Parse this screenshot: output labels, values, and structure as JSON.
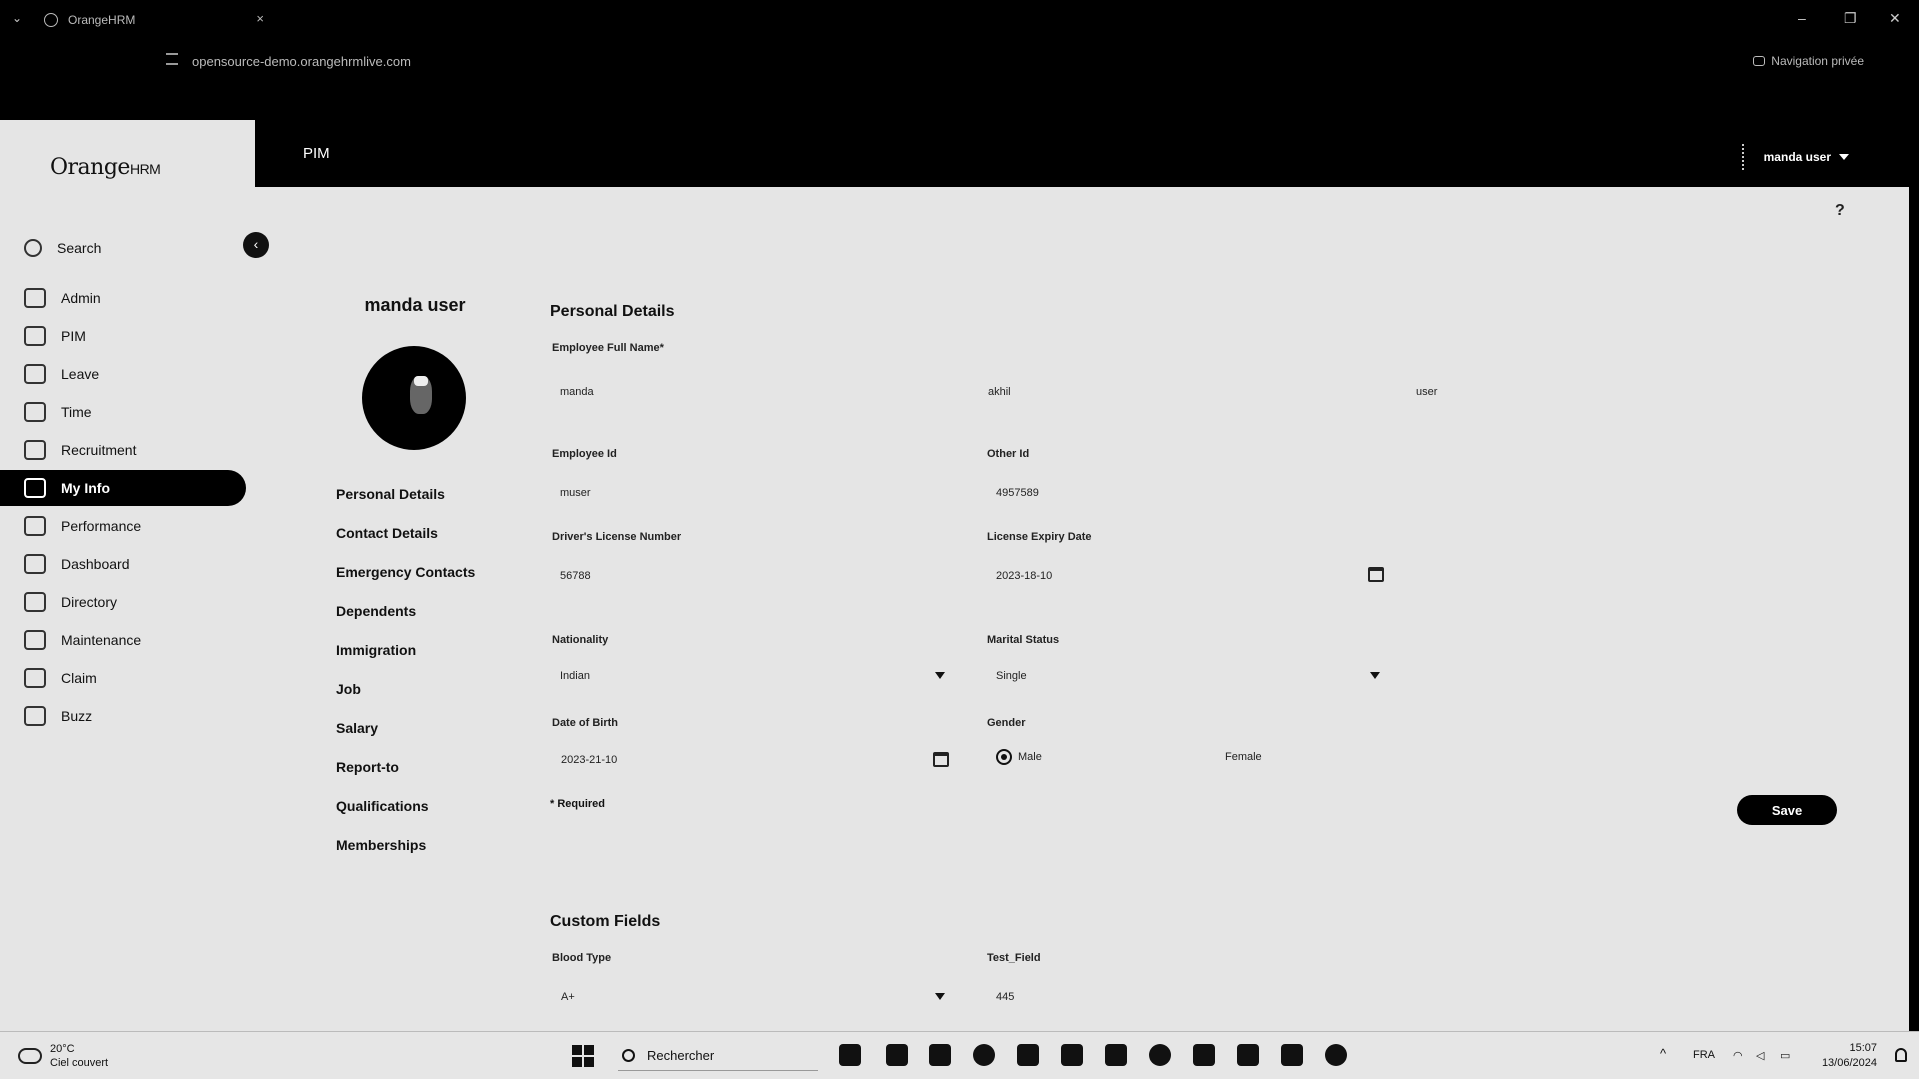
{
  "browser": {
    "tab_title": "OrangeHRM",
    "tab_close": "×",
    "url": "opensource-demo.orangehrmlive.com",
    "private_label": "Navigation privée",
    "minimize": "–",
    "restore": "❐",
    "close": "✕"
  },
  "app": {
    "logo_main": "Orange",
    "logo_suffix": "HRM",
    "header_title": "PIM",
    "user_name": "manda user",
    "help": "?"
  },
  "sidebar": {
    "collapse": "‹",
    "items": [
      {
        "label": "Search",
        "icon": "search-icon"
      },
      {
        "label": "Admin",
        "icon": "admin-icon"
      },
      {
        "label": "PIM",
        "icon": "pim-icon"
      },
      {
        "label": "Leave",
        "icon": "leave-icon"
      },
      {
        "label": "Time",
        "icon": "time-icon"
      },
      {
        "label": "Recruitment",
        "icon": "recruitment-icon"
      },
      {
        "label": "My Info",
        "icon": "my-info-icon",
        "active": true
      },
      {
        "label": "Performance",
        "icon": "performance-icon"
      },
      {
        "label": "Dashboard",
        "icon": "dashboard-icon"
      },
      {
        "label": "Directory",
        "icon": "directory-icon"
      },
      {
        "label": "Maintenance",
        "icon": "maintenance-icon"
      },
      {
        "label": "Claim",
        "icon": "claim-icon"
      },
      {
        "label": "Buzz",
        "icon": "buzz-icon"
      }
    ]
  },
  "profile": {
    "name": "manda user",
    "subnav": [
      "Personal Details",
      "Contact Details",
      "Emergency Contacts",
      "Dependents",
      "Immigration",
      "Job",
      "Salary",
      "Report-to",
      "Qualifications",
      "Memberships"
    ]
  },
  "personal": {
    "title": "Personal Details",
    "full_name_label": "Employee Full Name*",
    "first_name": "manda",
    "middle_name": "akhil",
    "last_name": "user",
    "employee_id_label": "Employee Id",
    "employee_id": "muser",
    "other_id_label": "Other Id",
    "other_id": "4957589",
    "license_label": "Driver's License Number",
    "license": "56788",
    "license_expiry_label": "License Expiry Date",
    "license_expiry": "2023-18-10",
    "nationality_label": "Nationality",
    "nationality": "Indian",
    "marital_label": "Marital Status",
    "marital": "Single",
    "dob_label": "Date of Birth",
    "dob": "2023-21-10",
    "gender_label": "Gender",
    "gender_male": "Male",
    "gender_female": "Female",
    "required_note": "* Required",
    "save_label": "Save"
  },
  "custom": {
    "title": "Custom Fields",
    "blood_type_label": "Blood Type",
    "blood_type": "A+",
    "test_field_label": "Test_Field",
    "test_field": "445"
  },
  "taskbar": {
    "temperature": "20°C",
    "weather": "Ciel couvert",
    "search_placeholder": "Rechercher",
    "language": "FRA",
    "time": "15:07",
    "date": "13/06/2024",
    "tray_chevron": "^"
  }
}
